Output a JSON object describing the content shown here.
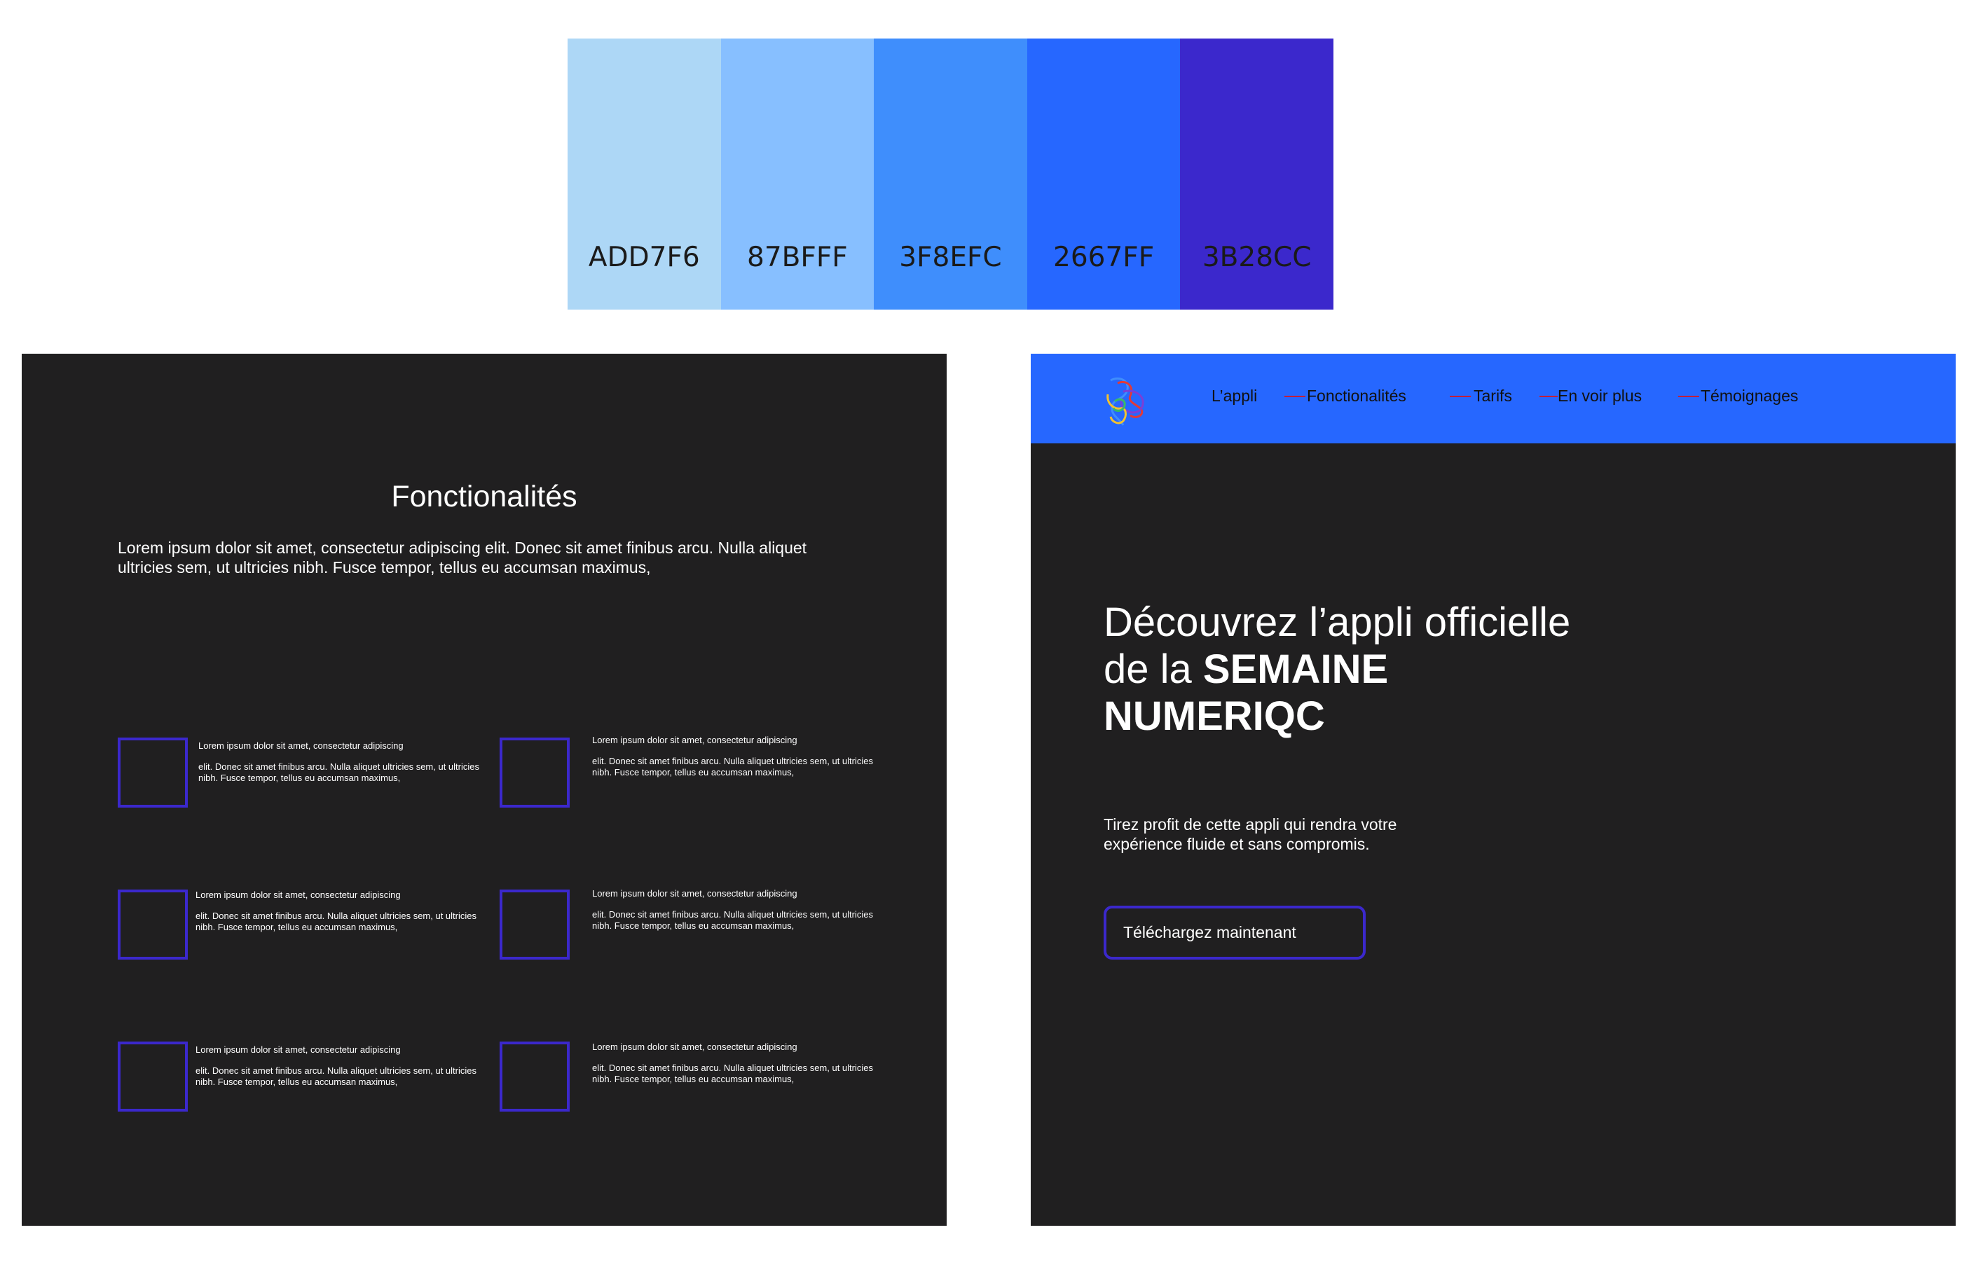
{
  "palette": {
    "swatches": [
      {
        "code": "ADD7F6",
        "color": "#ADD7F6"
      },
      {
        "code": "87BFFF",
        "color": "#87BFFF"
      },
      {
        "code": "3F8EFC",
        "color": "#3F8EFC"
      },
      {
        "code": "2667FF",
        "color": "#2667FF"
      },
      {
        "code": "3B28CC",
        "color": "#3B28CC"
      }
    ]
  },
  "features_panel": {
    "title": "Fonctionalités",
    "intro": "Lorem ipsum dolor sit amet, consectetur adipiscing elit. Donec sit amet finibus arcu. Nulla aliquet ultricies sem, ut ultricies nibh. Fusce tempor, tellus eu accumsan maximus,",
    "items": [
      {
        "heading": "Lorem ipsum dolor sit amet, consectetur adipiscing",
        "body": "elit. Donec sit amet finibus arcu. Nulla aliquet ultricies sem, ut ultricies nibh. Fusce tempor, tellus eu accumsan maximus,"
      },
      {
        "heading": "Lorem ipsum dolor sit amet, consectetur adipiscing",
        "body": "elit. Donec sit amet finibus arcu. Nulla aliquet ultricies sem, ut ultricies nibh. Fusce tempor, tellus eu accumsan maximus,"
      },
      {
        "heading": "Lorem ipsum dolor sit amet, consectetur adipiscing",
        "body": "elit. Donec sit amet finibus arcu. Nulla aliquet ultricies sem, ut ultricies nibh. Fusce tempor, tellus eu accumsan maximus,"
      },
      {
        "heading": "Lorem ipsum dolor sit amet, consectetur adipiscing",
        "body": "elit. Donec sit amet finibus arcu. Nulla aliquet ultricies sem, ut ultricies nibh. Fusce tempor, tellus eu accumsan maximus,"
      },
      {
        "heading": "Lorem ipsum dolor sit amet, consectetur adipiscing",
        "body": "elit. Donec sit amet finibus arcu. Nulla aliquet ultricies sem, ut ultricies nibh. Fusce tempor, tellus eu accumsan maximus,"
      },
      {
        "heading": "Lorem ipsum dolor sit amet, consectetur adipiscing",
        "body": "elit. Donec sit amet finibus arcu. Nulla aliquet ultricies sem, ut ultricies nibh. Fusce tempor, tellus eu accumsan maximus,"
      }
    ]
  },
  "landing": {
    "nav": {
      "logo_icon": "multicolor-outline-heads-icon",
      "items": [
        "L’appli",
        "Fonctionalités",
        "Tarifs",
        "En voir plus",
        "Témoignages"
      ]
    },
    "hero": {
      "title_regular": "Découvrez l’appli officielle de la ",
      "title_bold": "SEMAINE NUMERIQC",
      "subtitle": "Tirez profit de cette appli qui rendra votre expérience fluide et sans compromis.",
      "cta_label": "Téléchargez maintenant"
    }
  },
  "colors": {
    "panel_background": "#201F20",
    "nav_background": "#2667FF",
    "accent": "#3B28CC",
    "nav_tick": "#C21F3A",
    "text": "#FFFFFF"
  }
}
